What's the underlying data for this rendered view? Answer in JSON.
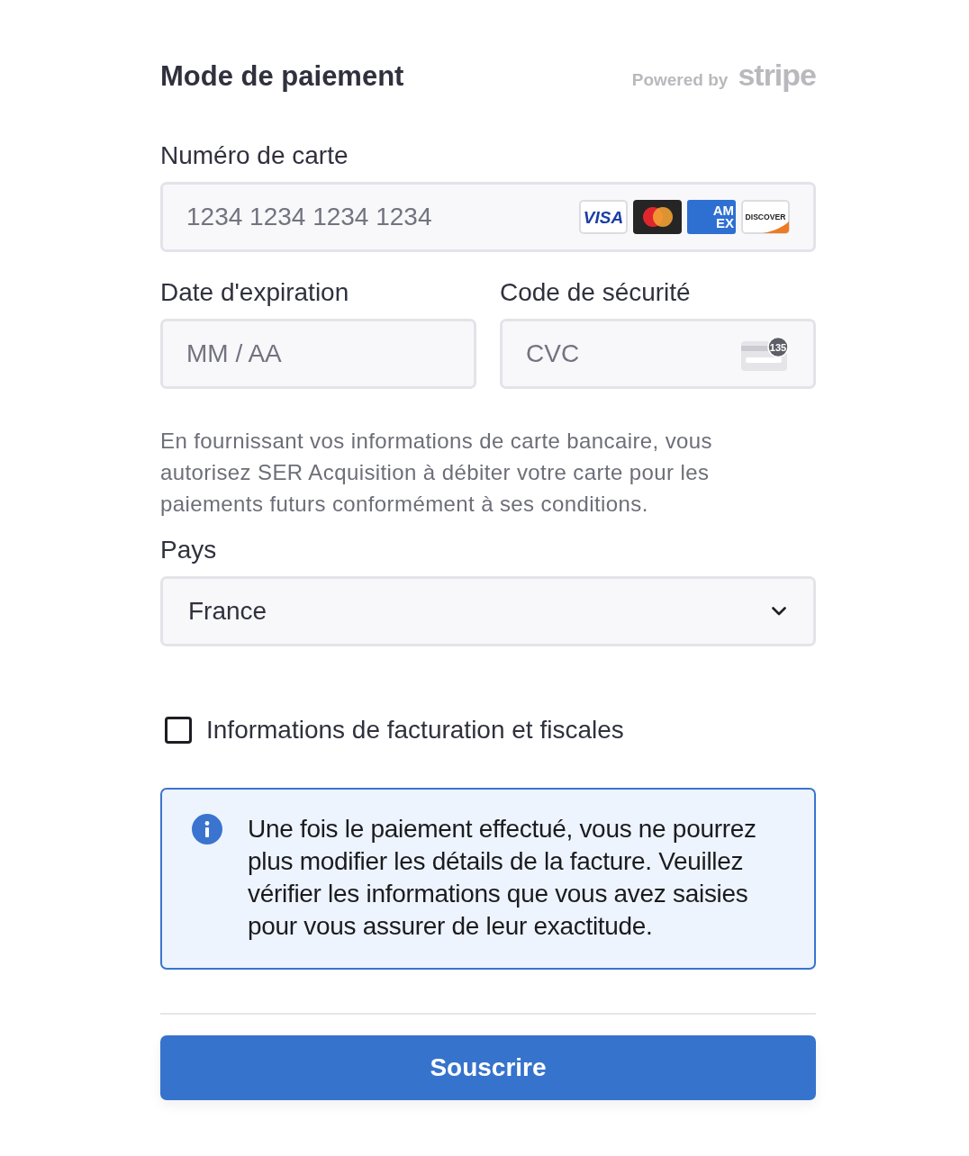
{
  "header": {
    "title": "Mode de paiement",
    "powered_by": "Powered by",
    "brand": "stripe"
  },
  "card_number": {
    "label": "Numéro de carte",
    "placeholder": "1234 1234 1234 1234",
    "brands": [
      {
        "kind": "visa",
        "text": "VISA"
      },
      {
        "kind": "mastercard"
      },
      {
        "kind": "amex",
        "lines": [
          "AM",
          "EX"
        ]
      },
      {
        "kind": "discover",
        "text": "DISCOVER"
      }
    ]
  },
  "expiry": {
    "label": "Date d'expiration",
    "placeholder": "MM / AA"
  },
  "cvc": {
    "label": "Code de sécurité",
    "placeholder": "CVC",
    "hint": "135"
  },
  "mandate_text": "En fournissant vos informations de carte bancaire, vous autorisez SER Acquisition à débiter votre carte pour les paiements futurs conformément à ses conditions.",
  "country": {
    "label": "Pays",
    "value": "France"
  },
  "billing_checkbox": {
    "label": "Informations de facturation et fiscales",
    "checked": false
  },
  "notice": {
    "text": "Une fois le paiement effectué, vous ne pourrez plus modifier les détails de la facture. Veuillez vérifier les informations que vous avez saisies pour vous assurer de leur exactitude."
  },
  "submit_button": {
    "label": "Souscrire"
  }
}
